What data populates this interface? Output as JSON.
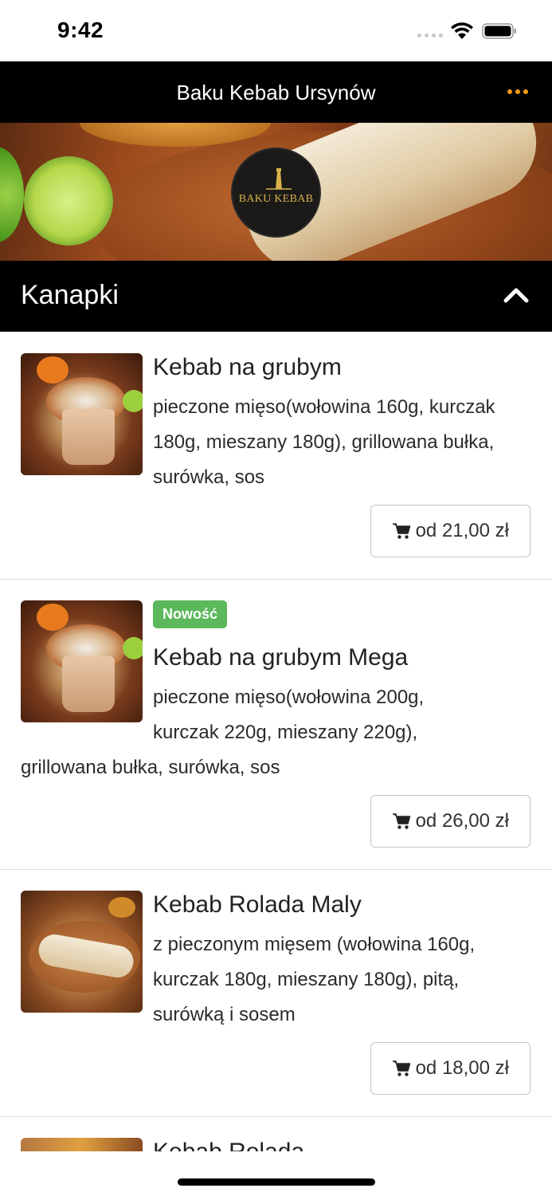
{
  "status_bar": {
    "time": "9:42"
  },
  "header": {
    "title": "Baku Kebab Ursynów",
    "menu_icon": "more-horizontal-icon",
    "menu_color": "#f39c12"
  },
  "banner": {
    "logo_text": "BAKU KEBAB"
  },
  "section": {
    "title": "Kanapki",
    "toggle_icon": "chevron-up-icon"
  },
  "items": [
    {
      "name": "Kebab na grubym",
      "description": "pieczone mięso(wołowina 160g, kurczak 180g, mieszany 180g), grillowana bułka, surówka, sos",
      "price": "od 21,00 zł"
    },
    {
      "badge": "Nowość",
      "badge_color": "#5cb85c",
      "name": "Kebab na grubym Mega",
      "description_part1": "pieczone mięso(wołowina 200g, kurczak 220g, mieszany 220g),",
      "description_part2": "grillowana bułka, surówka, sos",
      "price": "od 26,00 zł"
    },
    {
      "name": "Kebab Rolada Maly",
      "description": "z pieczonym mięsem (wołowina 160g, kurczak 180g, mieszany 180g), pitą, surówką i sosem",
      "price": "od 18,00 zł"
    },
    {
      "name": "Kebab Rolada"
    }
  ]
}
